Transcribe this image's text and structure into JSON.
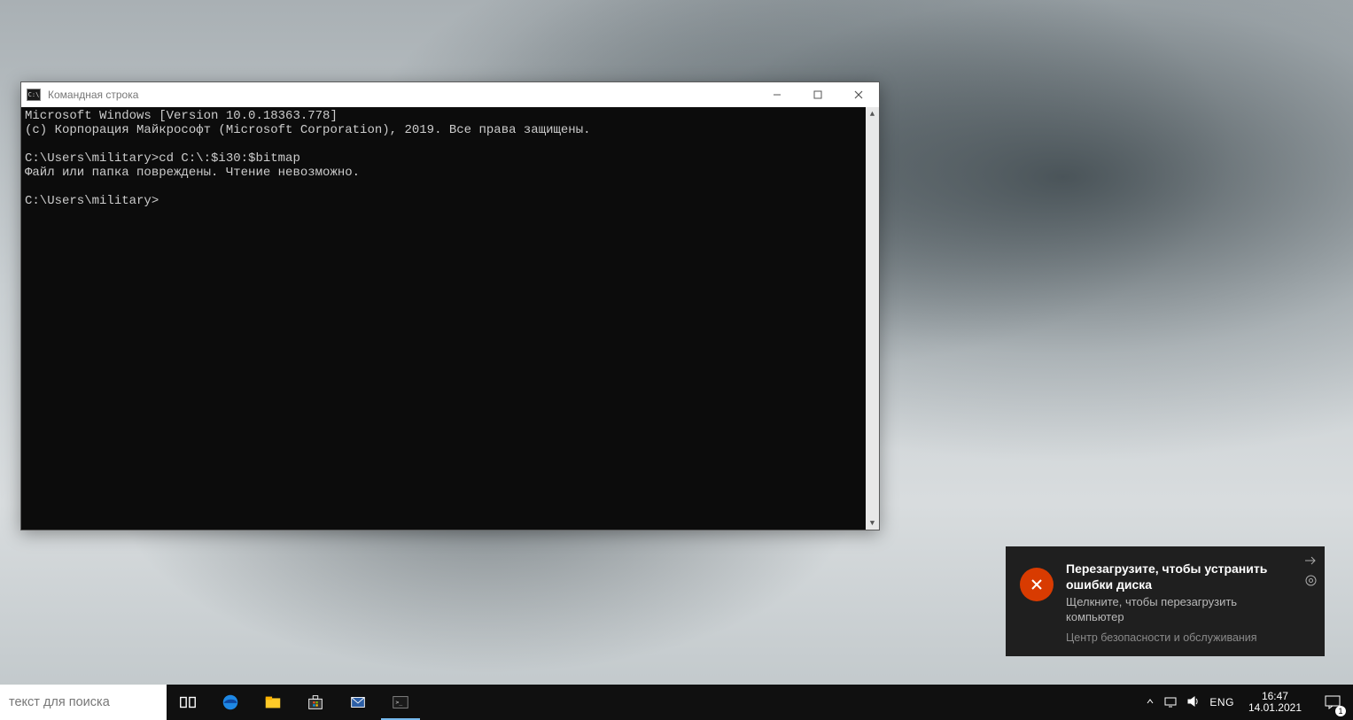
{
  "window": {
    "title": "Командная строка",
    "icon_text": "C:\\",
    "lines": {
      "l0": "Microsoft Windows [Version 10.0.18363.778]",
      "l1": "(c) Корпорация Майкрософт (Microsoft Corporation), 2019. Все права защищены.",
      "l2": "",
      "l3": "C:\\Users\\military>cd C:\\:$i30:$bitmap",
      "l4": "Файл или папка повреждены. Чтение невозможно.",
      "l5": "",
      "l6": "C:\\Users\\military>"
    }
  },
  "toast": {
    "title": "Перезагрузите, чтобы устранить ошибки диска",
    "subtitle": "Щелкните, чтобы перезагрузить компьютер",
    "source": "Центр безопасности и обслуживания"
  },
  "taskbar": {
    "search_placeholder": "текст для поиска",
    "lang": "ENG",
    "time": "16:47",
    "date": "14.01.2021",
    "notif_count": "1"
  }
}
